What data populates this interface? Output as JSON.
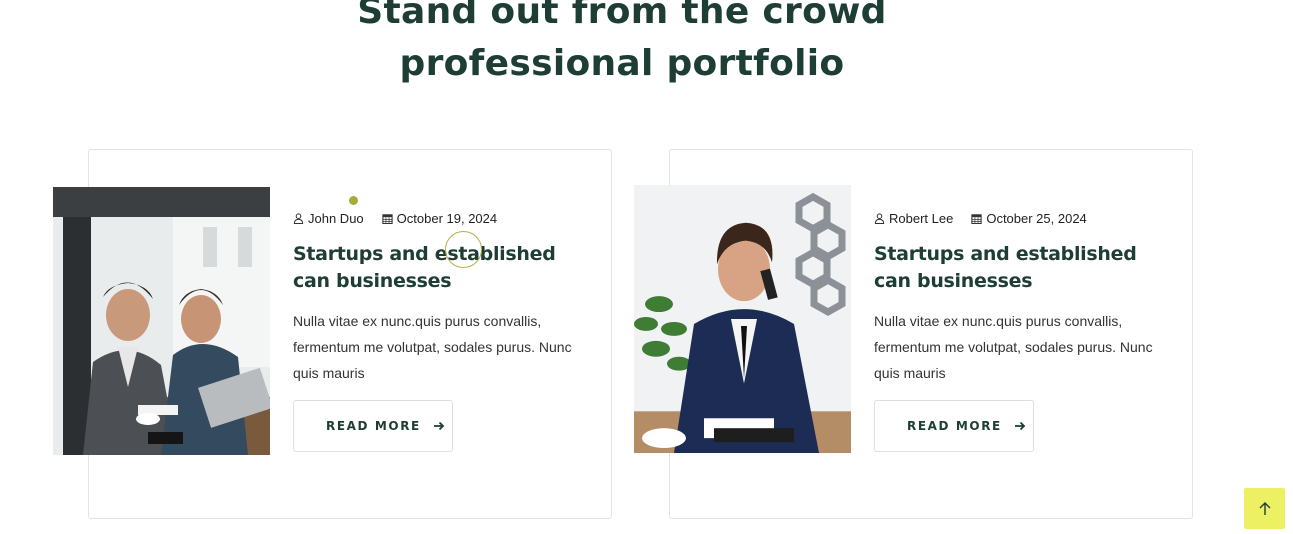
{
  "section": {
    "heading_line1": "Stand out from the crowd",
    "heading_line2": "professional portfolio"
  },
  "posts": [
    {
      "author": "John Duo",
      "date": "October 19, 2024",
      "title": "Startups and established can businesses",
      "excerpt": "Nulla vitae ex nunc.quis purus convallis, fermentum me volutpat, sodales purus. Nunc quis mauris",
      "button_label": "READ MORE"
    },
    {
      "author": "Robert Lee",
      "date": "October 25, 2024",
      "title": "Startups and established can businesses",
      "excerpt": "Nulla vitae ex nunc.quis purus convallis, fermentum me volutpat, sodales purus. Nunc quis mauris",
      "button_label": "READ MORE"
    }
  ],
  "icons": {
    "author": "user-icon",
    "date": "calendar-icon",
    "button": "arrow-right-icon",
    "scroll_top": "arrow-up-icon"
  },
  "colors": {
    "heading": "#1d3d35",
    "accent_dot": "#a3ad3a",
    "scroll_button": "#eef064"
  }
}
